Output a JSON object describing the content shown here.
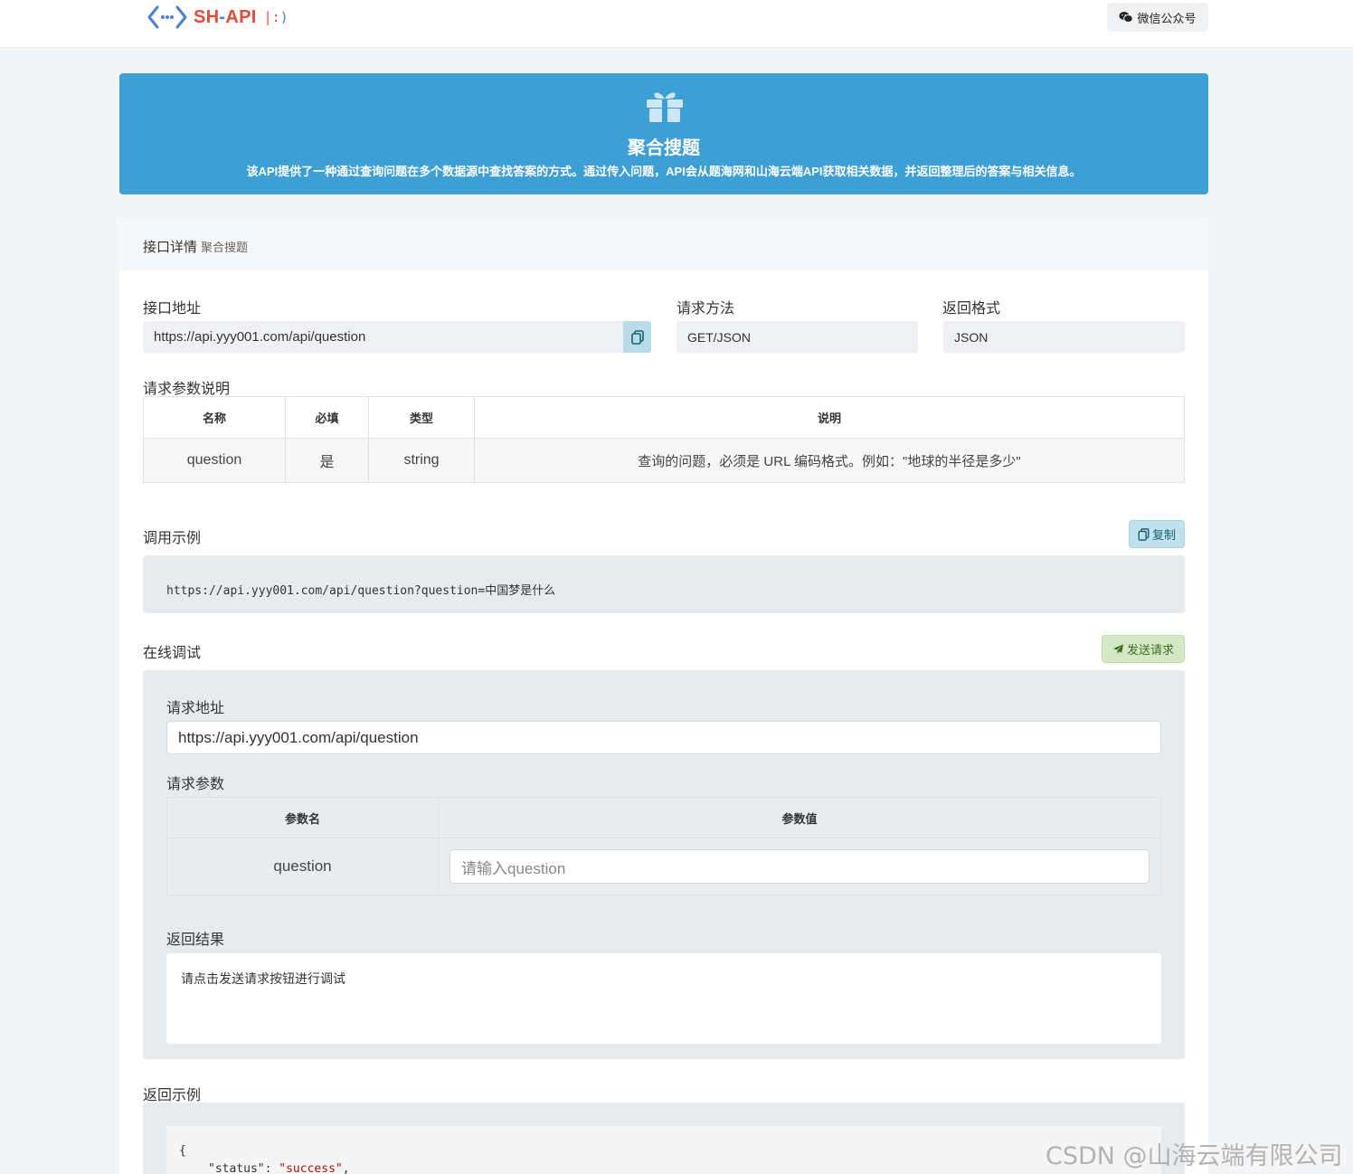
{
  "header": {
    "logo_sh": "SH",
    "logo_dash": "-",
    "logo_api": "API",
    "logo_mark_a": "|:",
    "logo_mark_b": ")",
    "wechat_label": "微信公众号"
  },
  "banner": {
    "title": "聚合搜题",
    "description": "该API提供了一种通过查询问题在多个数据源中查找答案的方式。通过传入问题，API会从题海网和山海云端API获取相关数据，并返回整理后的答案与相关信息。",
    "color": "#3d9fd3"
  },
  "detail": {
    "heading": "接口详情",
    "subheading": "聚合搜题",
    "endpoint_label": "接口地址",
    "endpoint_value": "https://api.yyy001.com/api/question",
    "method_label": "请求方法",
    "method_value": "GET/JSON",
    "format_label": "返回格式",
    "format_value": "JSON"
  },
  "params": {
    "label": "请求参数说明",
    "headers": [
      "名称",
      "必填",
      "类型",
      "说明"
    ],
    "rows": [
      [
        "question",
        "是",
        "string",
        "查询的问题，必须是 URL 编码格式。例如：\"地球的半径是多少\""
      ]
    ]
  },
  "example": {
    "label": "调用示例",
    "copy_label": "复制",
    "code": "https://api.yyy001.com/api/question?question=中国梦是什么"
  },
  "debug": {
    "label": "在线调试",
    "send_label": "发送请求",
    "url_label": "请求地址",
    "url_value": "https://api.yyy001.com/api/question",
    "params_label": "请求参数",
    "table_headers": [
      "参数名",
      "参数值"
    ],
    "param_name": "question",
    "param_placeholder": "请输入question",
    "result_label": "返回结果",
    "result_text": "请点击发送请求按钮进行调试"
  },
  "response_example": {
    "label": "返回示例",
    "line1": "{",
    "key": "\"status\"",
    "sep": ": ",
    "value": "\"success\"",
    "tail": ","
  },
  "watermark": "CSDN @山海云端有限公司"
}
